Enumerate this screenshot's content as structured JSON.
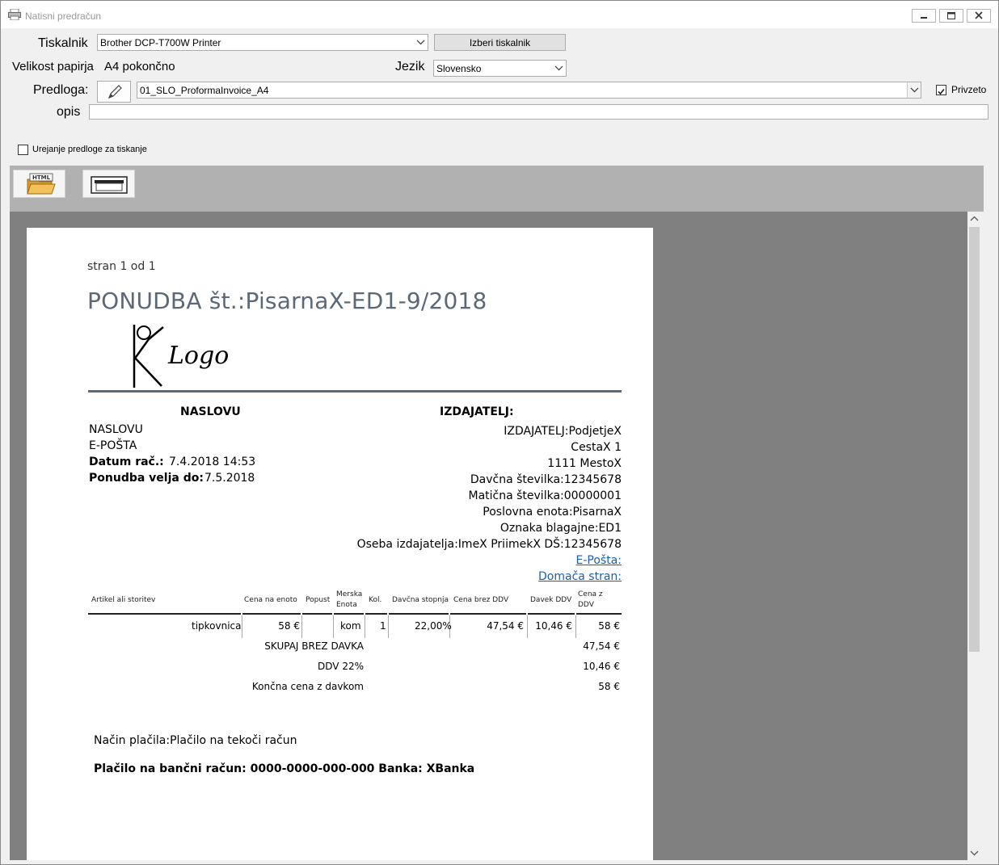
{
  "window": {
    "title": "Natisni predračun"
  },
  "form": {
    "printer_label": "Tiskalnik",
    "printer_value": "Brother DCP-T700W Printer",
    "choose_printer_button": "Izberi tiskalnik",
    "paper_label": "Velikost papirja",
    "paper_value": "A4 pokončno",
    "language_label": "Jezik",
    "language_value": "Slovensko",
    "template_label": "Predloga:",
    "template_value": "01_SLO_ProformaInvoice_A4",
    "default_label": "Privzeto",
    "default_checked": true,
    "description_label": "opis",
    "description_value": "",
    "edit_template_label": "Urejanje predloge za tiskanje",
    "edit_template_checked": false
  },
  "toolbar": {
    "html_icon_text": "HTML"
  },
  "document": {
    "page_info": "stran  1 od 1",
    "title": "PONUDBA št.:PisarnaX-ED1-9/2018",
    "logo_text": "Logo",
    "recipient_heading": "NASLOVU",
    "recipient_lines": [
      "NASLOVU",
      "E-POŠTA"
    ],
    "date_label": "Datum rač.:",
    "date_value": "7.4.2018 14:53",
    "valid_label": "Ponudba velja do:",
    "valid_value": "7.5.2018",
    "issuer_heading": "IZDAJATELJ:",
    "issuer_lines": [
      "IZDAJATELJ:PodjetjeX",
      "CestaX 1",
      "1111 MestoX",
      "Davčna številka:12345678",
      "Matična številka:00000001",
      "Poslovna enota:PisarnaX",
      "Oznaka blagajne:ED1",
      "Oseba izdajatelja:ImeX PriimekX DŠ:12345678"
    ],
    "issuer_links": [
      "E-Pošta:",
      "Domača stran:"
    ],
    "table": {
      "headers": [
        "Artikel ali storitev",
        "Cena na enoto",
        "Popust",
        "Merska Enota",
        "Kol.",
        "Davčna stopnja",
        "Cena brez DDV",
        "Davek DDV",
        "Cena z DDV"
      ],
      "row": [
        "tipkovnica",
        "58 €",
        "",
        "kom",
        "1",
        "22,00%",
        "47,54 €",
        "10,46 €",
        "58 €"
      ]
    },
    "totals": [
      {
        "label": "SKUPAJ BREZ DAVKA",
        "value": "47,54 €"
      },
      {
        "label": "DDV 22%",
        "value": "10,46 €"
      },
      {
        "label": "Končna cena z davkom",
        "value": "58 €"
      }
    ],
    "payment_method": "Način plačila:Plačilo na tekoči račun",
    "bank_info": "Plačilo na bančni račun: 0000-0000-000-000 Banka: XBanka"
  }
}
